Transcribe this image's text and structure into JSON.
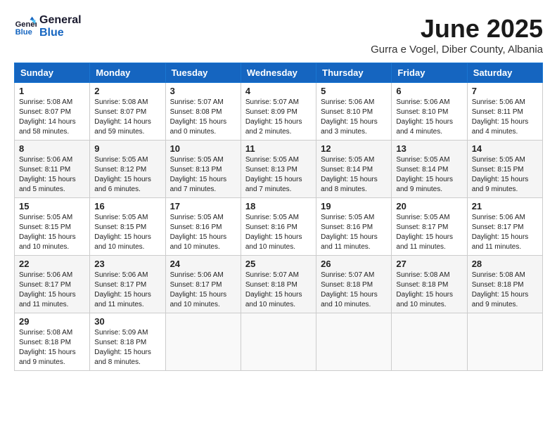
{
  "header": {
    "logo_line1": "General",
    "logo_line2": "Blue",
    "month_title": "June 2025",
    "location": "Gurra e Vogel, Diber County, Albania"
  },
  "weekdays": [
    "Sunday",
    "Monday",
    "Tuesday",
    "Wednesday",
    "Thursday",
    "Friday",
    "Saturday"
  ],
  "weeks": [
    [
      {
        "day": "1",
        "sunrise": "5:08 AM",
        "sunset": "8:07 PM",
        "daylight": "14 hours and 58 minutes."
      },
      {
        "day": "2",
        "sunrise": "5:08 AM",
        "sunset": "8:07 PM",
        "daylight": "14 hours and 59 minutes."
      },
      {
        "day": "3",
        "sunrise": "5:07 AM",
        "sunset": "8:08 PM",
        "daylight": "15 hours and 0 minutes."
      },
      {
        "day": "4",
        "sunrise": "5:07 AM",
        "sunset": "8:09 PM",
        "daylight": "15 hours and 2 minutes."
      },
      {
        "day": "5",
        "sunrise": "5:06 AM",
        "sunset": "8:10 PM",
        "daylight": "15 hours and 3 minutes."
      },
      {
        "day": "6",
        "sunrise": "5:06 AM",
        "sunset": "8:10 PM",
        "daylight": "15 hours and 4 minutes."
      },
      {
        "day": "7",
        "sunrise": "5:06 AM",
        "sunset": "8:11 PM",
        "daylight": "15 hours and 4 minutes."
      }
    ],
    [
      {
        "day": "8",
        "sunrise": "5:06 AM",
        "sunset": "8:11 PM",
        "daylight": "15 hours and 5 minutes."
      },
      {
        "day": "9",
        "sunrise": "5:05 AM",
        "sunset": "8:12 PM",
        "daylight": "15 hours and 6 minutes."
      },
      {
        "day": "10",
        "sunrise": "5:05 AM",
        "sunset": "8:13 PM",
        "daylight": "15 hours and 7 minutes."
      },
      {
        "day": "11",
        "sunrise": "5:05 AM",
        "sunset": "8:13 PM",
        "daylight": "15 hours and 7 minutes."
      },
      {
        "day": "12",
        "sunrise": "5:05 AM",
        "sunset": "8:14 PM",
        "daylight": "15 hours and 8 minutes."
      },
      {
        "day": "13",
        "sunrise": "5:05 AM",
        "sunset": "8:14 PM",
        "daylight": "15 hours and 9 minutes."
      },
      {
        "day": "14",
        "sunrise": "5:05 AM",
        "sunset": "8:15 PM",
        "daylight": "15 hours and 9 minutes."
      }
    ],
    [
      {
        "day": "15",
        "sunrise": "5:05 AM",
        "sunset": "8:15 PM",
        "daylight": "15 hours and 10 minutes."
      },
      {
        "day": "16",
        "sunrise": "5:05 AM",
        "sunset": "8:15 PM",
        "daylight": "15 hours and 10 minutes."
      },
      {
        "day": "17",
        "sunrise": "5:05 AM",
        "sunset": "8:16 PM",
        "daylight": "15 hours and 10 minutes."
      },
      {
        "day": "18",
        "sunrise": "5:05 AM",
        "sunset": "8:16 PM",
        "daylight": "15 hours and 10 minutes."
      },
      {
        "day": "19",
        "sunrise": "5:05 AM",
        "sunset": "8:16 PM",
        "daylight": "15 hours and 11 minutes."
      },
      {
        "day": "20",
        "sunrise": "5:05 AM",
        "sunset": "8:17 PM",
        "daylight": "15 hours and 11 minutes."
      },
      {
        "day": "21",
        "sunrise": "5:06 AM",
        "sunset": "8:17 PM",
        "daylight": "15 hours and 11 minutes."
      }
    ],
    [
      {
        "day": "22",
        "sunrise": "5:06 AM",
        "sunset": "8:17 PM",
        "daylight": "15 hours and 11 minutes."
      },
      {
        "day": "23",
        "sunrise": "5:06 AM",
        "sunset": "8:17 PM",
        "daylight": "15 hours and 11 minutes."
      },
      {
        "day": "24",
        "sunrise": "5:06 AM",
        "sunset": "8:17 PM",
        "daylight": "15 hours and 10 minutes."
      },
      {
        "day": "25",
        "sunrise": "5:07 AM",
        "sunset": "8:18 PM",
        "daylight": "15 hours and 10 minutes."
      },
      {
        "day": "26",
        "sunrise": "5:07 AM",
        "sunset": "8:18 PM",
        "daylight": "15 hours and 10 minutes."
      },
      {
        "day": "27",
        "sunrise": "5:08 AM",
        "sunset": "8:18 PM",
        "daylight": "15 hours and 10 minutes."
      },
      {
        "day": "28",
        "sunrise": "5:08 AM",
        "sunset": "8:18 PM",
        "daylight": "15 hours and 9 minutes."
      }
    ],
    [
      {
        "day": "29",
        "sunrise": "5:08 AM",
        "sunset": "8:18 PM",
        "daylight": "15 hours and 9 minutes."
      },
      {
        "day": "30",
        "sunrise": "5:09 AM",
        "sunset": "8:18 PM",
        "daylight": "15 hours and 8 minutes."
      },
      null,
      null,
      null,
      null,
      null
    ]
  ]
}
